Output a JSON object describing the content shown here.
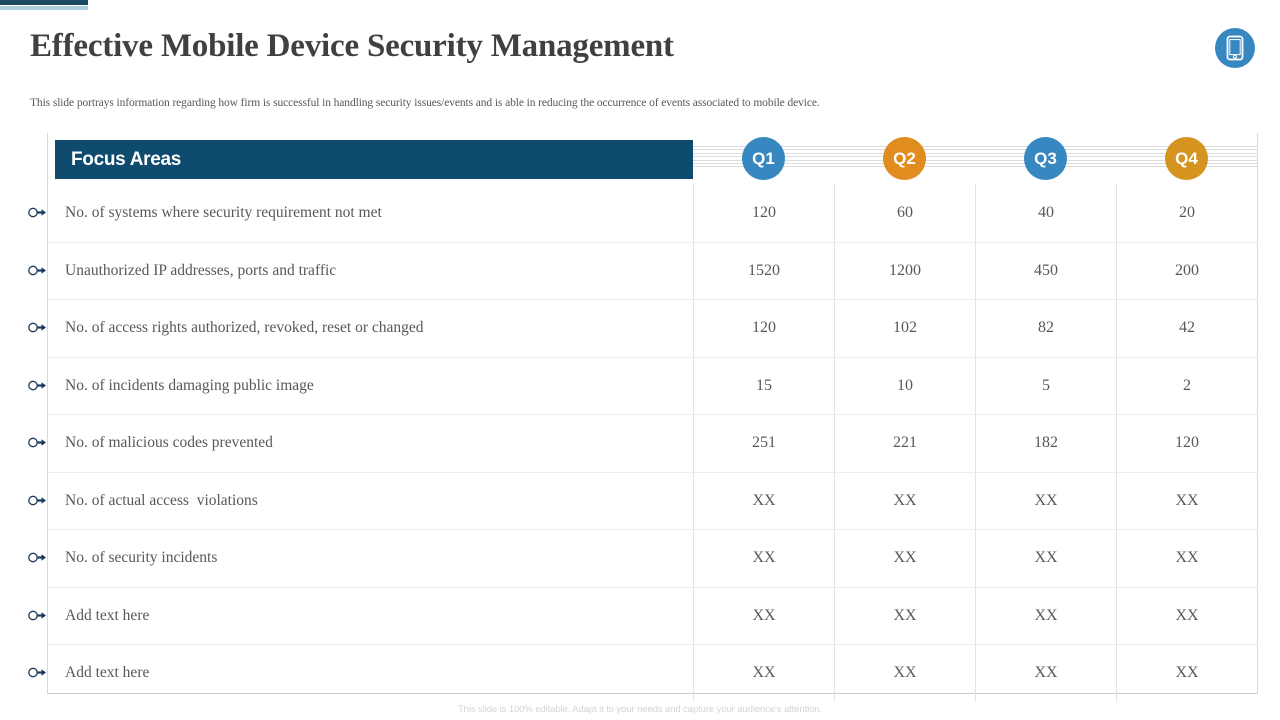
{
  "header": {
    "title": "Effective Mobile Device Security Management",
    "subtitle": "This slide portrays information regarding how firm is successful in handling security issues/events and is able in reducing the occurrence of events associated to mobile device.",
    "icon": "mobile-device-icon",
    "icon_color": "#3787c0",
    "accent_dark": "#1b4a63",
    "accent_light": "#a9cfdf"
  },
  "table": {
    "focus_header": "Focus Areas",
    "focus_header_bg": "#0f4b6e",
    "quarters": [
      {
        "label": "Q1",
        "color": "#3787c0"
      },
      {
        "label": "Q2",
        "color": "#e08c1e"
      },
      {
        "label": "Q3",
        "color": "#3787c0"
      },
      {
        "label": "Q4",
        "color": "#d4941f"
      }
    ],
    "rows": [
      {
        "label": "No. of systems where security requirement not met",
        "values": [
          "120",
          "60",
          "40",
          "20"
        ]
      },
      {
        "label": "Unauthorized IP addresses, ports and traffic",
        "values": [
          "1520",
          "1200",
          "450",
          "200"
        ]
      },
      {
        "label": "No. of access rights authorized, revoked, reset or changed",
        "values": [
          "120",
          "102",
          "82",
          "42"
        ]
      },
      {
        "label": "No. of incidents damaging public image",
        "values": [
          "15",
          "10",
          "5",
          "2"
        ]
      },
      {
        "label": "No. of malicious codes prevented",
        "values": [
          "251",
          "221",
          "182",
          "120"
        ]
      },
      {
        "label": "No. of actual access  violations",
        "values": [
          "XX",
          "XX",
          "XX",
          "XX"
        ]
      },
      {
        "label": "No. of security incidents",
        "values": [
          "XX",
          "XX",
          "XX",
          "XX"
        ]
      },
      {
        "label": "Add text here",
        "values": [
          "XX",
          "XX",
          "XX",
          "XX"
        ]
      },
      {
        "label": "Add text here",
        "values": [
          "XX",
          "XX",
          "XX",
          "XX"
        ]
      }
    ],
    "bullet_icon": "key-arrow-icon"
  },
  "footer": {
    "note": "This slide is 100% editable. Adapt it to your needs and capture your audience's attention."
  }
}
